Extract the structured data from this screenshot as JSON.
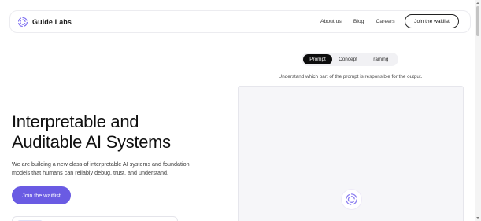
{
  "header": {
    "brand_name": "Guide Labs",
    "logo_icon": "spiral-logo-icon",
    "nav_links": [
      "About us",
      "Blog",
      "Careers"
    ],
    "cta_label": "Join the waitlist"
  },
  "hero": {
    "title_line1": "Interpretable and",
    "title_line2": "Auditable AI Systems",
    "subtitle": "We are building a new class of interpretable AI systems and foundation models that humans can reliably debug, trust, and understand.",
    "cta_label": "Join the waitlist"
  },
  "demo": {
    "tabs": [
      {
        "label": "Prompt",
        "active": true
      },
      {
        "label": "Concept",
        "active": false
      },
      {
        "label": "Training",
        "active": false
      }
    ],
    "description": "Understand which part of the prompt is responsible for the output.",
    "loading_icon": "spiral-loading-icon"
  },
  "colors": {
    "accent": "#6a5be3",
    "logo_purple": "#7b6cf0",
    "active_tab": "#0d0d0d",
    "panel_bg": "#f6f6f9"
  }
}
